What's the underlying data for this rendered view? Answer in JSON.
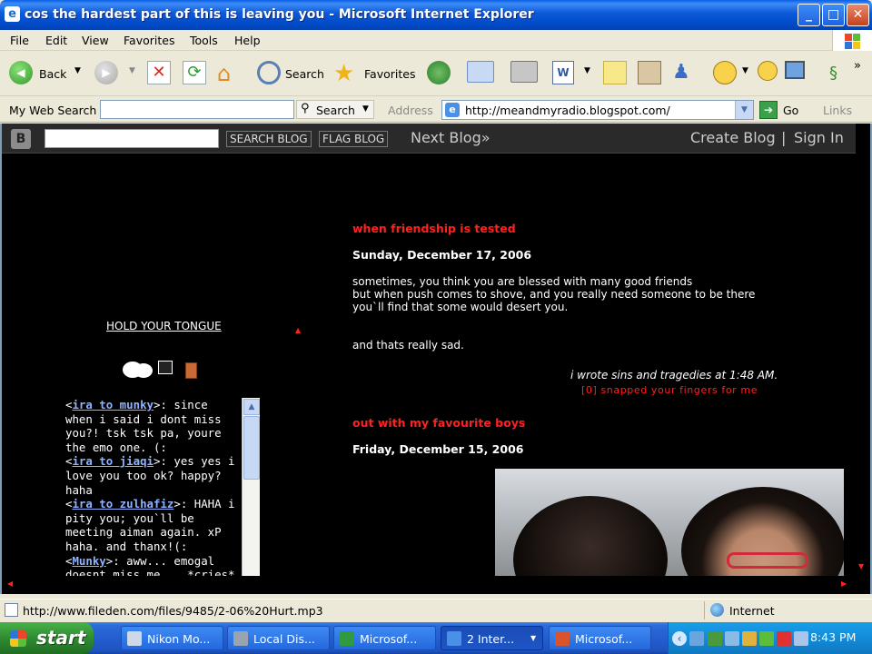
{
  "window": {
    "title": "cos the hardest part of this is leaving you - Microsoft Internet Explorer",
    "controls": {
      "minimize": "_",
      "maximize": "□",
      "close": "✕"
    }
  },
  "menu": [
    "File",
    "Edit",
    "View",
    "Favorites",
    "Tools",
    "Help"
  ],
  "toolbar": {
    "back": "Back",
    "search": "Search",
    "favorites": "Favorites",
    "chevron": "»"
  },
  "addressbar": {
    "mywebsearch": "My Web Search",
    "search_btn": "Search",
    "address_label": "Address",
    "url": "http://meandmyradio.blogspot.com/",
    "go": "Go",
    "links": "Links"
  },
  "navbar": {
    "search_blog": "SEARCH BLOG",
    "flag_blog": "FLAG BLOG",
    "next_blog": "Next Blog»",
    "create_blog": "Create Blog",
    "separator": "|",
    "sign_in": "Sign In"
  },
  "sidebar": {
    "hold": "HOLD YOUR TONGUE",
    "chat": [
      {
        "open": "<",
        "name": "ira to munky",
        "text": ">: since when i said i dont miss you?! tsk tsk pa, youre the emo one. (:"
      },
      {
        "open": "<",
        "name": "ira to jiaqi",
        "text": ">: yes yes i love you too ok? happy? haha"
      },
      {
        "open": "<",
        "name": "ira to zulhafiz",
        "text": ">: HAHA i pity you; you`ll be meeting aiman again. xP haha. and thanx!(:"
      },
      {
        "open": "<",
        "name": "Munky",
        "text": ">: aww... emogal doesnt miss me... *cries*"
      }
    ]
  },
  "posts": [
    {
      "title": "when friendship is tested",
      "date": "Sunday, December 17, 2006",
      "body": [
        "sometimes, you think you are blessed with many good friends",
        "but when push comes to shove, and you really need someone to be there",
        "you`ll find that some would desert you.",
        "",
        "",
        "and thats really sad."
      ],
      "footer": "i wrote sins and tragedies at 1:48 AM.",
      "comments": "[0] snapped your fingers for me"
    },
    {
      "title": "out with my favourite boys",
      "date": "Friday, December 15, 2006"
    }
  ],
  "status": {
    "url": "http://www.fileden.com/files/9485/2-06%20Hurt.mp3",
    "zone": "Internet"
  },
  "taskbar": {
    "start": "start",
    "tasks": [
      {
        "label": "Nikon Mo...",
        "color": "#cfd8e8"
      },
      {
        "label": "Local Dis...",
        "color": "#9aa3b1"
      },
      {
        "label": "Microsof...",
        "color": "#2f9a3f"
      },
      {
        "label": "2 Inter...",
        "color": "#4a90e8"
      },
      {
        "label": "Microsof...",
        "color": "#d9532c"
      }
    ],
    "clock": "8:43 PM"
  }
}
